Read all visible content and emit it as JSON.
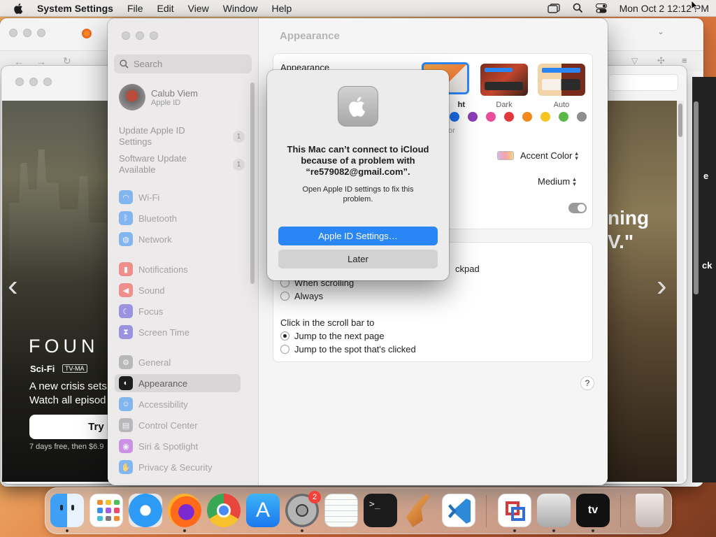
{
  "menubar": {
    "items": [
      "System Settings",
      "File",
      "Edit",
      "View",
      "Window",
      "Help"
    ],
    "clock": "Mon Oct 2  12:12 PM"
  },
  "tv": {
    "logo": "FOUN",
    "genre": "Sci-Fi",
    "rating": "TV-MA",
    "line1": "A new crisis sets",
    "line2": "Watch all episod",
    "try_button": "Try It",
    "fineprint": "7 days free, then $6.9",
    "right_line1": "ning",
    "right_line2": "V.\"",
    "edge1": "e",
    "edge2": "ck"
  },
  "settings": {
    "search_placeholder": "Search",
    "account": {
      "name": "Calub Viem",
      "sub": "Apple ID"
    },
    "updates": [
      {
        "label": "Update Apple ID Settings",
        "count": "1"
      },
      {
        "label": "Software Update Available",
        "count": "1"
      }
    ],
    "sidebar": [
      {
        "label": "Wi-Fi",
        "icon": "wifi-icon",
        "color": "#2f8cf2"
      },
      {
        "label": "Bluetooth",
        "icon": "bluetooth-icon",
        "color": "#2f8cf2"
      },
      {
        "label": "Network",
        "icon": "globe-icon",
        "color": "#2f8cf2"
      },
      {
        "label": "Notifications",
        "icon": "bell-icon",
        "color": "#f0463f"
      },
      {
        "label": "Sound",
        "icon": "speaker-icon",
        "color": "#f0463f"
      },
      {
        "label": "Focus",
        "icon": "moon-icon",
        "color": "#5a4bd8"
      },
      {
        "label": "Screen Time",
        "icon": "hourglass-icon",
        "color": "#5a4bd8"
      },
      {
        "label": "General",
        "icon": "gear-icon",
        "color": "#8e8e93"
      },
      {
        "label": "Appearance",
        "icon": "appearance-icon",
        "color": "#1d1d1f"
      },
      {
        "label": "Accessibility",
        "icon": "accessibility-icon",
        "color": "#2f8cf2"
      },
      {
        "label": "Control Center",
        "icon": "control-center-icon",
        "color": "#8e8e93"
      },
      {
        "label": "Siri & Spotlight",
        "icon": "siri-icon",
        "color": "#b04adf"
      },
      {
        "label": "Privacy & Security",
        "icon": "hand-icon",
        "color": "#2f8cf2"
      }
    ],
    "selected": "Appearance",
    "content": {
      "title": "Appearance",
      "appearance_label": "Appearance",
      "themes": [
        {
          "label": "ht"
        },
        {
          "label": "Dark"
        },
        {
          "label": "Auto"
        }
      ],
      "accent_colors": [
        "#1a6ff0",
        "#8a3db4",
        "#ea4d9c",
        "#e2393b",
        "#f08a1f",
        "#f6c423",
        "#5bb748",
        "#8e8e8e"
      ],
      "accent_label_partial": "or",
      "highlight_value": "Accent Color",
      "sidebar_size_value": "Medium",
      "scroll_partial": "ckpad",
      "scroll_options": [
        "When scrolling",
        "Always"
      ],
      "click_label": "Click in the scroll bar to",
      "click_options": [
        "Jump to the next page",
        "Jump to the spot that's clicked"
      ],
      "help": "?"
    }
  },
  "dialog": {
    "title": "This Mac can’t connect to iCloud because of a problem with “re579082@gmail.com”.",
    "message": "Open Apple ID settings to fix this problem.",
    "primary": "Apple ID Settings…",
    "secondary": "Later"
  },
  "dock": {
    "badge_settings": "2",
    "tv_label": "tv"
  }
}
